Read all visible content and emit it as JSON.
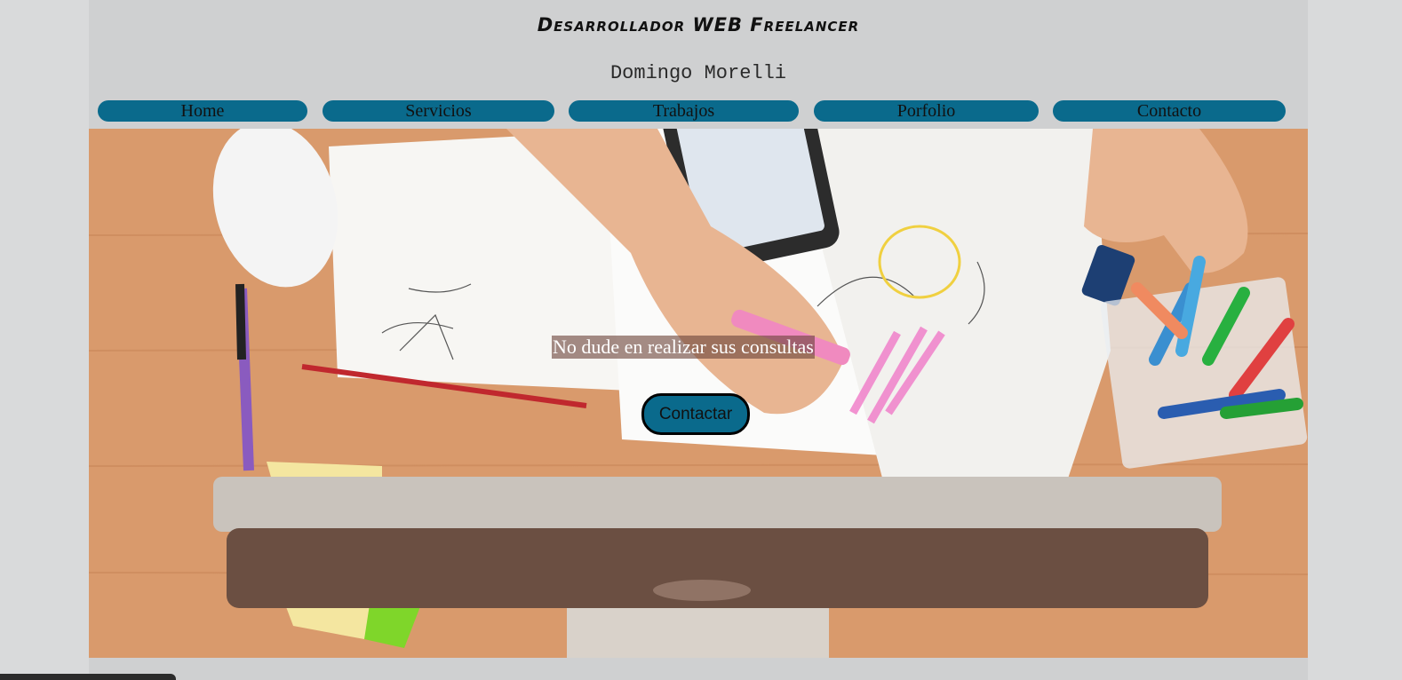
{
  "header": {
    "title": "Desarrollador WEB Freelancer",
    "author": "Domingo Morelli"
  },
  "nav": {
    "items": [
      {
        "label": "Home"
      },
      {
        "label": "Servicios"
      },
      {
        "label": "Trabajos"
      },
      {
        "label": "Porfolio"
      },
      {
        "label": "Contacto"
      }
    ]
  },
  "hero": {
    "tagline": "No dude en realizar sus consultas",
    "cta_label": "Contactar",
    "image_subject": "desk-workspace-photo"
  },
  "colors": {
    "page_bg": "#cfd0d1",
    "nav_bg": "#0a6a8c",
    "cta_bg": "#0a6a8c",
    "desk": "#d99a6c"
  }
}
